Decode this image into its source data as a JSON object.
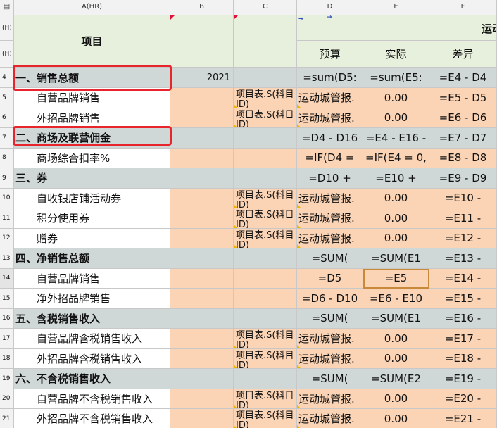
{
  "columns": {
    "corner": "▤",
    "A": "A(HR)",
    "B": "B",
    "C": "C",
    "D": "D",
    "E": "E",
    "F": "F"
  },
  "header": {
    "h1": "(H)",
    "h2": "(H)",
    "item": "项目",
    "group": "运动",
    "budget": "预算",
    "actual": "实际",
    "diff": "差异"
  },
  "rows": [
    {
      "num": "4",
      "a": "一、销售总额",
      "b": "2021",
      "c": "",
      "d": "=sum(D5:",
      "e": "=sum(E5:",
      "f": "=E4 - D4"
    },
    {
      "num": "5",
      "a": "自营品牌销售",
      "b": "",
      "c": "项目表.S(科目ID)",
      "d": "运动城管报.",
      "e": "0.00",
      "f": "=E5 - D5"
    },
    {
      "num": "6",
      "a": "外招品牌销售",
      "b": "",
      "c": "项目表.S(科目ID)",
      "d": "运动城管报.",
      "e": "0.00",
      "f": "=E6 - D6"
    },
    {
      "num": "7",
      "a": "二、商场及联营佣金",
      "b": "",
      "c": "",
      "d": "=D4 - D16",
      "e": "=E4 - E16 -",
      "f": "=E7 - D7"
    },
    {
      "num": "8",
      "a": "商场综合扣率%",
      "b": "",
      "c": "",
      "d": "=IF(D4 =",
      "e": "=IF(E4 = 0,",
      "f": "=E8 - D8"
    },
    {
      "num": "9",
      "a": "三、券",
      "b": "",
      "c": "",
      "d": "=D10 +",
      "e": "=E10 +",
      "f": "=E9 - D9"
    },
    {
      "num": "10",
      "a": "自收银店铺活动券",
      "b": "",
      "c": "项目表.S(科目ID)",
      "d": "运动城管报.",
      "e": "0.00",
      "f": "=E10 -"
    },
    {
      "num": "11",
      "a": "积分使用券",
      "b": "",
      "c": "项目表.S(科目ID)",
      "d": "运动城管报.",
      "e": "0.00",
      "f": "=E11 -"
    },
    {
      "num": "12",
      "a": "赠券",
      "b": "",
      "c": "项目表.S(科目ID)",
      "d": "运动城管报.",
      "e": "0.00",
      "f": "=E12 -"
    },
    {
      "num": "13",
      "a": "四、净销售总额",
      "b": "",
      "c": "",
      "d": "=SUM(",
      "e": "=SUM(E1",
      "f": "=E13 -"
    },
    {
      "num": "14",
      "a": "自营品牌销售",
      "b": "",
      "c": "",
      "d": "=D5",
      "e": "=E5",
      "f": "=E14 -"
    },
    {
      "num": "15",
      "a": "净外招品牌销售",
      "b": "",
      "c": "",
      "d": "=D6 - D10",
      "e": "=E6 - E10",
      "f": "=E15 -"
    },
    {
      "num": "16",
      "a": "五、含税销售收入",
      "b": "",
      "c": "",
      "d": "=SUM(",
      "e": "=SUM(E1",
      "f": "=E16 -"
    },
    {
      "num": "17",
      "a": "自营品牌含税销售收入",
      "b": "",
      "c": "项目表.S(科目ID)",
      "d": "运动城管报.",
      "e": "0.00",
      "f": "=E17 -"
    },
    {
      "num": "18",
      "a": "外招品牌含税销售收入",
      "b": "",
      "c": "项目表.S(科目ID)",
      "d": "运动城管报.",
      "e": "0.00",
      "f": "=E18 -"
    },
    {
      "num": "19",
      "a": "六、不含税销售收入",
      "b": "",
      "c": "",
      "d": "=SUM(",
      "e": "=SUM(E2",
      "f": "=E19 -"
    },
    {
      "num": "20",
      "a": "自营品牌不含税销售收入",
      "b": "",
      "c": "项目表.S(科目ID)",
      "d": "运动城管报.",
      "e": "0.00",
      "f": "=E20 -"
    },
    {
      "num": "21",
      "a": "外招品牌不含税销售收入",
      "b": "",
      "c": "项目表.S(科目ID)",
      "d": "运动城管报.",
      "e": "0.00",
      "f": "=E21 -"
    }
  ],
  "colors": {
    "header_green": "#e6f0dc",
    "section_gray": "#cfd8d6",
    "cell_peach": "#fbd4b5",
    "highlight_red": "#e8242c",
    "selection": "#c88a3a"
  },
  "selected_cell": "E14"
}
